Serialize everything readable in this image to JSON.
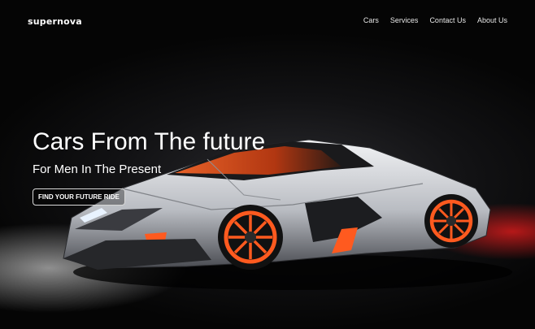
{
  "brand": {
    "logo": "supernova"
  },
  "nav": {
    "items": [
      {
        "label": "Cars"
      },
      {
        "label": "Services"
      },
      {
        "label": "Contact Us"
      },
      {
        "label": "About Us"
      }
    ]
  },
  "hero": {
    "title": "Cars From The future",
    "subtitle": "For Men In The Present",
    "cta_label": "FIND YOUR FUTURE RIDE",
    "image_icon": "supercar-image"
  },
  "colors": {
    "background": "#0a0a0a",
    "accent": "#ff5a1f",
    "text": "#ffffff",
    "car_body": "#c9ccd1"
  }
}
